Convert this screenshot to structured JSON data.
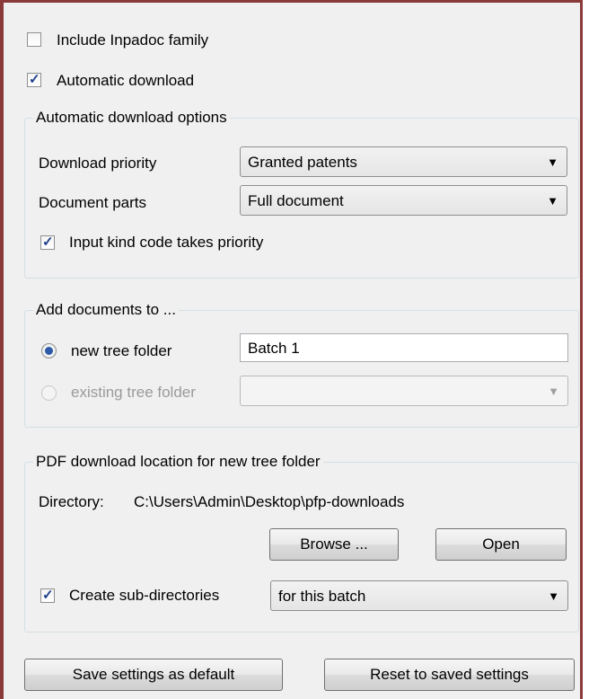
{
  "options": {
    "include_inpadoc_label": "Include Inpadoc family",
    "include_inpadoc_checked": false,
    "automatic_download_label": "Automatic download",
    "automatic_download_checked": true
  },
  "auto_download_group": {
    "legend": "Automatic download options",
    "priority_label": "Download priority",
    "priority_value": "Granted patents",
    "parts_label": "Document parts",
    "parts_value": "Full document",
    "kind_code_label": "Input kind code takes priority",
    "kind_code_checked": true
  },
  "add_documents_group": {
    "legend": "Add documents to ...",
    "new_folder_label": "new tree folder",
    "new_folder_value": "Batch 1",
    "new_folder_selected": true,
    "existing_folder_label": "existing tree folder",
    "existing_folder_value": ""
  },
  "pdf_group": {
    "legend": "PDF download location for new tree folder",
    "directory_label": "Directory:",
    "directory_path": "C:\\Users\\Admin\\Desktop\\pfp-downloads",
    "browse_label": "Browse ...",
    "open_label": "Open",
    "subdirs_label": "Create sub-directories",
    "subdirs_checked": true,
    "subdirs_value": "for this batch"
  },
  "footer": {
    "save_default_label": "Save settings as default",
    "reset_label": "Reset to saved settings"
  },
  "icons": {
    "check": "checkmark-icon",
    "dropdown": "chevron-down-icon"
  },
  "colors": {
    "window_border": "#8b3a3a",
    "panel_background": "#f0f0f0",
    "check_color": "#1e3f8a"
  }
}
